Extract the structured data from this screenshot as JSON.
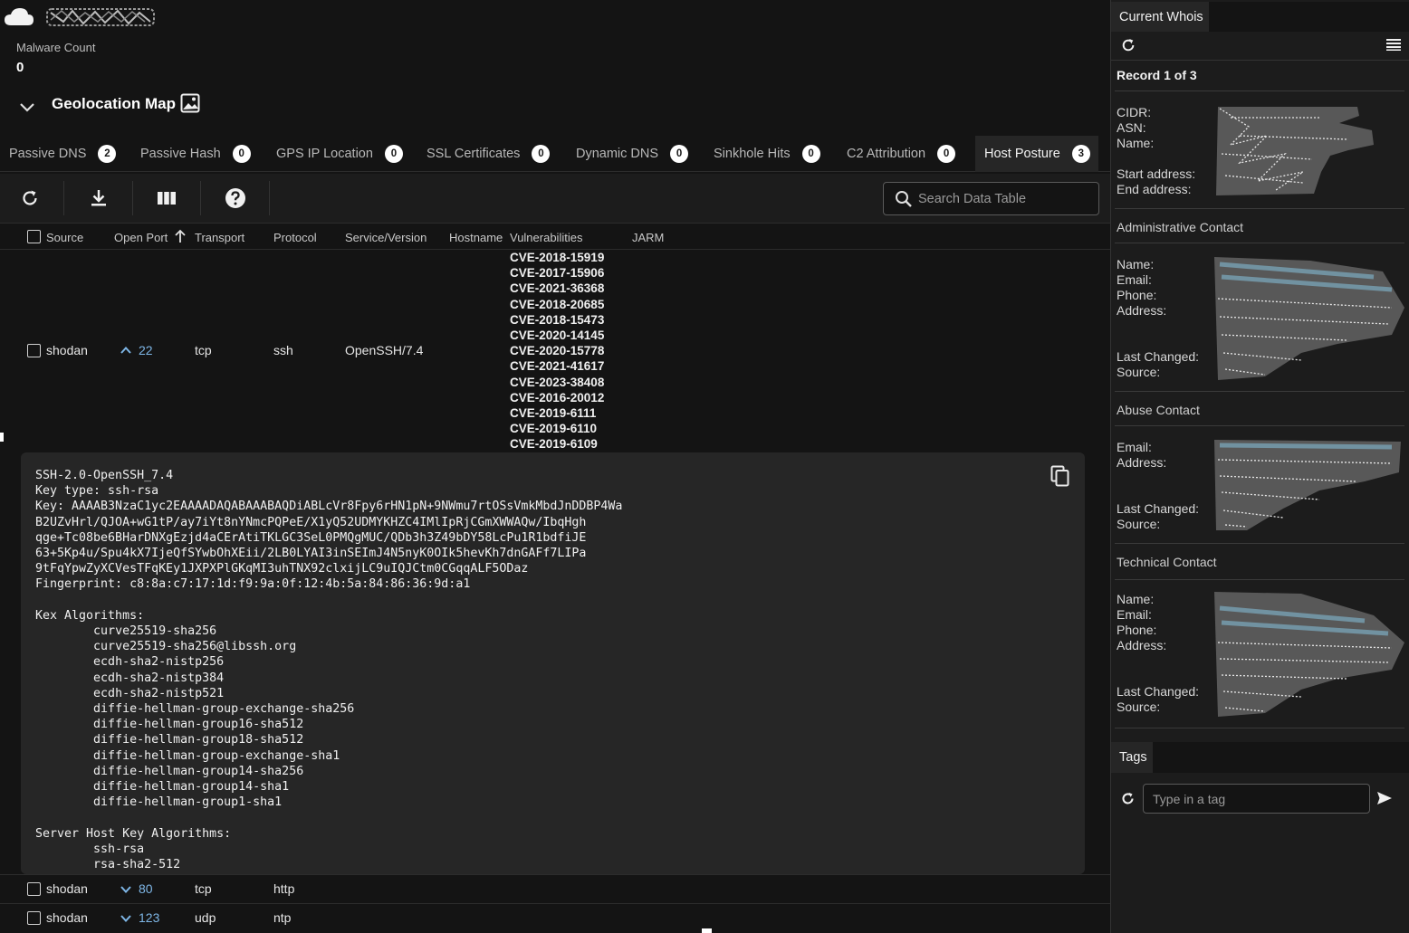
{
  "header": {
    "malware_count_label": "Malware Count",
    "malware_count_value": "0",
    "geo_title": "Geolocation Map"
  },
  "tabs": [
    {
      "label": "Passive DNS",
      "count": "2"
    },
    {
      "label": "Passive Hash",
      "count": "0"
    },
    {
      "label": "GPS IP Location",
      "count": "0"
    },
    {
      "label": "SSL Certificates",
      "count": "0"
    },
    {
      "label": "Dynamic DNS",
      "count": "0"
    },
    {
      "label": "Sinkhole Hits",
      "count": "0"
    },
    {
      "label": "C2 Attribution",
      "count": "0"
    },
    {
      "label": "Host Posture",
      "count": "3",
      "active": true
    }
  ],
  "toolbar": {
    "search_placeholder": "Search Data Table",
    "icons": [
      "refresh-icon",
      "download-icon",
      "columns-icon",
      "help-icon"
    ]
  },
  "table": {
    "columns": [
      "Source",
      "Open Port",
      "Transport",
      "Protocol",
      "Service/Version",
      "Hostname",
      "Vulnerabilities",
      "JARM"
    ],
    "sort_column": "Open Port",
    "sort_direction": "ascending",
    "rows": [
      {
        "source": "shodan",
        "port": "22",
        "transport": "tcp",
        "protocol": "ssh",
        "service": "OpenSSH/7.4",
        "hostname": "",
        "expanded": true,
        "vulnerabilities": [
          "CVE-2018-15919",
          "CVE-2017-15906",
          "CVE-2021-36368",
          "CVE-2018-20685",
          "CVE-2018-15473",
          "CVE-2020-14145",
          "CVE-2020-15778",
          "CVE-2021-41617",
          "CVE-2023-38408",
          "CVE-2016-20012",
          "CVE-2019-6111",
          "CVE-2019-6110",
          "CVE-2019-6109"
        ],
        "banner": "SSH-2.0-OpenSSH_7.4\nKey type: ssh-rsa\nKey: AAAAB3NzaC1yc2EAAAADAQABAAABAQDiABLcVr8Fpy6rHN1pN+9NWmu7rtOSsVmkMbdJnDDBP4Wa\nB2UZvHrl/QJOA+wG1tP/ay7iYt8nYNmcPQPeE/X1yQ52UDMYKHZC4IMlIpRjCGmXWWAQw/IbqHgh\nqge+Tc08be6BHarDNXgEzjd4aCErAtiTKLGC3SeL0PMQgMUC/QDb3h3Z49bDY58LcPu1R1bdfiJE\n63+5Kp4u/Spu4kX7IjeQfSYwbOhXEii/2LB0LYAI3inSEImJ4N5nyK0OIk5hevKh7dnGAFf7LIPa\n9tFqYpwZyXCVesTFqKEy1JXPXPlGKqMI3uhTNX92clxijLC9uIQJCtm0CGqqALF5ODaz\nFingerprint: c8:8a:c7:17:1d:f9:9a:0f:12:4b:5a:84:86:36:9d:a1\n\nKex Algorithms:\n\tcurve25519-sha256\n\tcurve25519-sha256@libssh.org\n\tecdh-sha2-nistp256\n\tecdh-sha2-nistp384\n\tecdh-sha2-nistp521\n\tdiffie-hellman-group-exchange-sha256\n\tdiffie-hellman-group16-sha512\n\tdiffie-hellman-group18-sha512\n\tdiffie-hellman-group-exchange-sha1\n\tdiffie-hellman-group14-sha256\n\tdiffie-hellman-group14-sha1\n\tdiffie-hellman-group1-sha1\n\nServer Host Key Algorithms:\n\tssh-rsa\n\trsa-sha2-512"
      },
      {
        "source": "shodan",
        "port": "80",
        "transport": "tcp",
        "protocol": "http",
        "service": "",
        "hostname": "",
        "expanded": false
      },
      {
        "source": "shodan",
        "port": "123",
        "transport": "udp",
        "protocol": "ntp",
        "service": "",
        "hostname": "",
        "expanded": false
      }
    ]
  },
  "whois": {
    "tab_label": "Current Whois",
    "record_label": "Record 1 of 3",
    "network_fields": [
      "CIDR:",
      "ASN:",
      "Name:",
      "",
      "Start address:",
      "End address:"
    ],
    "admin_title": "Administrative Contact",
    "admin_fields": [
      "Name:",
      "Email:",
      "Phone:",
      "Address:",
      "",
      "",
      "Last Changed:",
      "Source:"
    ],
    "abuse_title": "Abuse Contact",
    "abuse_fields": [
      "Email:",
      "Address:",
      "",
      "",
      "Last Changed:",
      "Source:"
    ],
    "tech_title": "Technical Contact",
    "tech_fields": [
      "Name:",
      "Email:",
      "Phone:",
      "Address:",
      "",
      "",
      "Last Changed:",
      "Source:"
    ]
  },
  "tags": {
    "tab_label": "Tags",
    "placeholder": "Type in a tag"
  },
  "colors": {
    "background": "#141414",
    "panel": "#1c1c1c",
    "accent_link": "#7eb6e6",
    "badge_bg": "#ffffff"
  }
}
